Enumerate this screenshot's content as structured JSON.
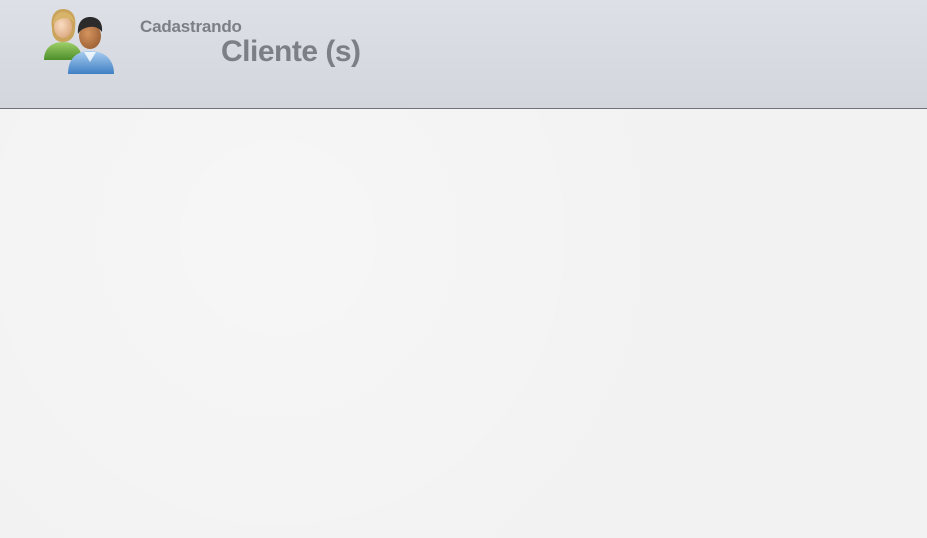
{
  "header": {
    "icon": "users-icon",
    "subtitle": "Cadastrando",
    "title": "Cliente (s)"
  },
  "colors": {
    "header_bg": "#d6d9df",
    "header_border": "#6f7278",
    "title_text": "#7c7f86",
    "content_bg": "#f2f2f2"
  }
}
